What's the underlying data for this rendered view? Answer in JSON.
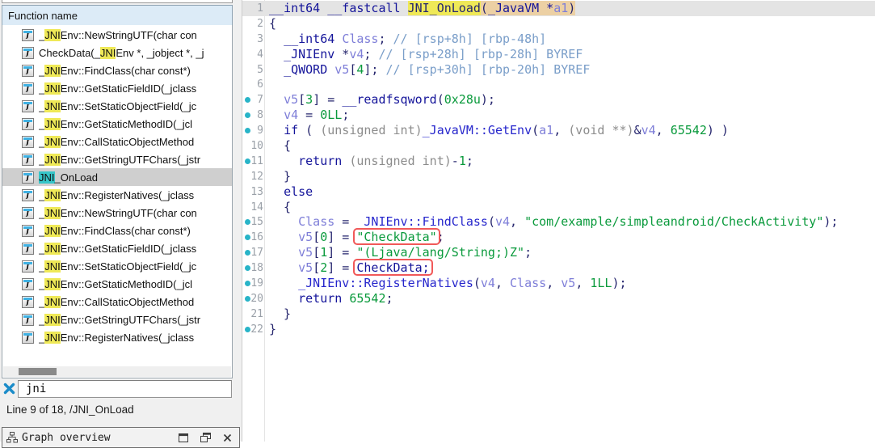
{
  "function_list": {
    "header": "Function name",
    "icon_glyph": "f",
    "items": [
      {
        "pre": "_",
        "hl": "JNI",
        "post": "Env::NewStringUTF(char con",
        "selected": false
      },
      {
        "pre": "CheckData(_",
        "hl": "JNI",
        "post": "Env *, _jobject *, _j",
        "selected": false
      },
      {
        "pre": "_",
        "hl": "JNI",
        "post": "Env::FindClass(char const*)",
        "selected": false
      },
      {
        "pre": "_",
        "hl": "JNI",
        "post": "Env::GetStaticFieldID(_jclass",
        "selected": false
      },
      {
        "pre": "_",
        "hl": "JNI",
        "post": "Env::SetStaticObjectField(_jc",
        "selected": false
      },
      {
        "pre": "_",
        "hl": "JNI",
        "post": "Env::GetStaticMethodID(_jcl",
        "selected": false
      },
      {
        "pre": "_",
        "hl": "JNI",
        "post": "Env::CallStaticObjectMethod",
        "selected": false
      },
      {
        "pre": "_",
        "hl": "JNI",
        "post": "Env::GetStringUTFChars(_jstr",
        "selected": false
      },
      {
        "pre": "",
        "hl": "JNI",
        "post": "_OnLoad",
        "selected": true
      },
      {
        "pre": "_",
        "hl": "JNI",
        "post": "Env::RegisterNatives(_jclass ",
        "selected": false
      },
      {
        "pre": "_",
        "hl": "JNI",
        "post": "Env::NewStringUTF(char con",
        "selected": false
      },
      {
        "pre": "_",
        "hl": "JNI",
        "post": "Env::FindClass(char const*)",
        "selected": false
      },
      {
        "pre": "_",
        "hl": "JNI",
        "post": "Env::GetStaticFieldID(_jclass",
        "selected": false
      },
      {
        "pre": "_",
        "hl": "JNI",
        "post": "Env::SetStaticObjectField(_jc",
        "selected": false
      },
      {
        "pre": "_",
        "hl": "JNI",
        "post": "Env::GetStaticMethodID(_jcl",
        "selected": false
      },
      {
        "pre": "_",
        "hl": "JNI",
        "post": "Env::CallStaticObjectMethod",
        "selected": false
      },
      {
        "pre": "_",
        "hl": "JNI",
        "post": "Env::GetStringUTFChars(_jstr",
        "selected": false
      },
      {
        "pre": "_",
        "hl": "JNI",
        "post": "Env::RegisterNatives(_jclass ",
        "selected": false
      }
    ]
  },
  "search": {
    "value": "jni"
  },
  "status": "Line 9 of 18, /JNI_OnLoad",
  "overview_panel": {
    "title": "Graph overview"
  },
  "colors": {
    "highlight_yellow": "#efe957",
    "highlight_teal": "#36c5c8",
    "selection_gray": "#cfcfcf",
    "current_line": "#e4e4e4",
    "breakpoint_dot": "#28b4c8",
    "annotation_box_red": "#f15959",
    "search_close_blue": "#1b8cc9",
    "header_blue": "#dcebf7",
    "string_green": "#0a9a3c",
    "keyword_navy": "#14149a",
    "variable_periwinkle": "#7e7ed8",
    "comment_blue": "#7a9ec9"
  },
  "code": {
    "lines": [
      {
        "n": 1,
        "dot": false,
        "current": true,
        "segs": [
          {
            "c": "kw",
            "t": "__int64 __fastcall "
          },
          {
            "c": "def",
            "t": "JNI_OnLoad",
            "bg": "y"
          },
          {
            "c": "def",
            "t": "(",
            "bg": "t"
          },
          {
            "c": "kw",
            "t": "_JavaVM *",
            "bg": "t"
          },
          {
            "c": "var",
            "t": "a1",
            "bg": "t"
          },
          {
            "c": "def",
            "t": ")",
            "bg": "t"
          }
        ]
      },
      {
        "n": 2,
        "dot": false,
        "current": false,
        "segs": [
          {
            "c": "def",
            "t": "{"
          }
        ]
      },
      {
        "n": 3,
        "dot": false,
        "current": false,
        "segs": [
          {
            "c": "def",
            "t": "  "
          },
          {
            "c": "kw",
            "t": "__int64"
          },
          {
            "c": "def",
            "t": " "
          },
          {
            "c": "var",
            "t": "Class"
          },
          {
            "c": "def",
            "t": "; "
          },
          {
            "c": "com",
            "t": "// [rsp+8h] [rbp-48h]"
          }
        ]
      },
      {
        "n": 4,
        "dot": false,
        "current": false,
        "segs": [
          {
            "c": "def",
            "t": "  "
          },
          {
            "c": "kw",
            "t": "_JNIEnv"
          },
          {
            "c": "def",
            "t": " *"
          },
          {
            "c": "var",
            "t": "v4"
          },
          {
            "c": "def",
            "t": "; "
          },
          {
            "c": "com",
            "t": "// [rsp+28h] [rbp-28h] BYREF"
          }
        ]
      },
      {
        "n": 5,
        "dot": false,
        "current": false,
        "segs": [
          {
            "c": "def",
            "t": "  "
          },
          {
            "c": "kw",
            "t": "_QWORD"
          },
          {
            "c": "def",
            "t": " "
          },
          {
            "c": "var",
            "t": "v5"
          },
          {
            "c": "def",
            "t": "["
          },
          {
            "c": "grn",
            "t": "4"
          },
          {
            "c": "def",
            "t": "]; "
          },
          {
            "c": "com",
            "t": "// [rsp+30h] [rbp-20h] BYREF"
          }
        ]
      },
      {
        "n": 6,
        "dot": false,
        "current": false,
        "segs": []
      },
      {
        "n": 7,
        "dot": true,
        "current": false,
        "segs": [
          {
            "c": "def",
            "t": "  "
          },
          {
            "c": "var",
            "t": "v5"
          },
          {
            "c": "def",
            "t": "["
          },
          {
            "c": "grn",
            "t": "3"
          },
          {
            "c": "def",
            "t": "] = "
          },
          {
            "c": "kw",
            "t": "__readfsqword"
          },
          {
            "c": "def",
            "t": "("
          },
          {
            "c": "grn",
            "t": "0x28u"
          },
          {
            "c": "def",
            "t": ");"
          }
        ]
      },
      {
        "n": 8,
        "dot": true,
        "current": false,
        "segs": [
          {
            "c": "def",
            "t": "  "
          },
          {
            "c": "var",
            "t": "v4"
          },
          {
            "c": "def",
            "t": " = "
          },
          {
            "c": "grn",
            "t": "0LL"
          },
          {
            "c": "def",
            "t": ";"
          }
        ]
      },
      {
        "n": 9,
        "dot": true,
        "current": false,
        "segs": [
          {
            "c": "def",
            "t": "  "
          },
          {
            "c": "kw",
            "t": "if"
          },
          {
            "c": "def",
            "t": " ( "
          },
          {
            "c": "gray",
            "t": "(unsigned int)"
          },
          {
            "c": "fn",
            "t": "_JavaVM::GetEnv"
          },
          {
            "c": "def",
            "t": "("
          },
          {
            "c": "var",
            "t": "a1"
          },
          {
            "c": "def",
            "t": ", "
          },
          {
            "c": "gray",
            "t": "(void **)"
          },
          {
            "c": "def",
            "t": "&"
          },
          {
            "c": "var",
            "t": "v4"
          },
          {
            "c": "def",
            "t": ", "
          },
          {
            "c": "grn",
            "t": "65542"
          },
          {
            "c": "def",
            "t": ") )"
          }
        ]
      },
      {
        "n": 10,
        "dot": false,
        "current": false,
        "segs": [
          {
            "c": "def",
            "t": "  {"
          }
        ]
      },
      {
        "n": 11,
        "dot": true,
        "current": false,
        "segs": [
          {
            "c": "def",
            "t": "    "
          },
          {
            "c": "kw",
            "t": "return"
          },
          {
            "c": "def",
            "t": " "
          },
          {
            "c": "gray",
            "t": "(unsigned int)"
          },
          {
            "c": "def",
            "t": "-"
          },
          {
            "c": "grn",
            "t": "1"
          },
          {
            "c": "def",
            "t": ";"
          }
        ]
      },
      {
        "n": 12,
        "dot": false,
        "current": false,
        "segs": [
          {
            "c": "def",
            "t": "  }"
          }
        ]
      },
      {
        "n": 13,
        "dot": false,
        "current": false,
        "segs": [
          {
            "c": "def",
            "t": "  "
          },
          {
            "c": "kw",
            "t": "else"
          }
        ]
      },
      {
        "n": 14,
        "dot": false,
        "current": false,
        "segs": [
          {
            "c": "def",
            "t": "  {"
          }
        ]
      },
      {
        "n": 15,
        "dot": true,
        "current": false,
        "segs": [
          {
            "c": "def",
            "t": "    "
          },
          {
            "c": "var",
            "t": "Class"
          },
          {
            "c": "def",
            "t": " = "
          },
          {
            "c": "fn",
            "t": "_JNIEnv::FindClass"
          },
          {
            "c": "def",
            "t": "("
          },
          {
            "c": "var",
            "t": "v4"
          },
          {
            "c": "def",
            "t": ", "
          },
          {
            "c": "grn",
            "t": "\"com/example/simpleandroid/CheckActivity\""
          },
          {
            "c": "def",
            "t": ");"
          }
        ]
      },
      {
        "n": 16,
        "dot": true,
        "current": false,
        "segs": [
          {
            "c": "def",
            "t": "    "
          },
          {
            "c": "var",
            "t": "v5"
          },
          {
            "c": "def",
            "t": "["
          },
          {
            "c": "grn",
            "t": "0"
          },
          {
            "c": "def",
            "t": "] = "
          },
          {
            "c": "grn",
            "t": "\"CheckData\"",
            "b": true
          },
          {
            "c": "def",
            "t": ";"
          }
        ]
      },
      {
        "n": 17,
        "dot": true,
        "current": false,
        "segs": [
          {
            "c": "def",
            "t": "    "
          },
          {
            "c": "var",
            "t": "v5"
          },
          {
            "c": "def",
            "t": "["
          },
          {
            "c": "grn",
            "t": "1"
          },
          {
            "c": "def",
            "t": "] = "
          },
          {
            "c": "grn",
            "t": "\"(Ljava/lang/String;)Z\""
          },
          {
            "c": "def",
            "t": ";"
          }
        ]
      },
      {
        "n": 18,
        "dot": true,
        "current": false,
        "segs": [
          {
            "c": "def",
            "t": "    "
          },
          {
            "c": "var",
            "t": "v5"
          },
          {
            "c": "def",
            "t": "["
          },
          {
            "c": "grn",
            "t": "2"
          },
          {
            "c": "def",
            "t": "] = "
          },
          {
            "c": "kw",
            "t": "CheckData;",
            "b": true
          }
        ]
      },
      {
        "n": 19,
        "dot": true,
        "current": false,
        "segs": [
          {
            "c": "def",
            "t": "    "
          },
          {
            "c": "fn",
            "t": "_JNIEnv::RegisterNatives"
          },
          {
            "c": "def",
            "t": "("
          },
          {
            "c": "var",
            "t": "v4"
          },
          {
            "c": "def",
            "t": ", "
          },
          {
            "c": "var",
            "t": "Class"
          },
          {
            "c": "def",
            "t": ", "
          },
          {
            "c": "var",
            "t": "v5"
          },
          {
            "c": "def",
            "t": ", "
          },
          {
            "c": "grn",
            "t": "1LL"
          },
          {
            "c": "def",
            "t": ");"
          }
        ]
      },
      {
        "n": 20,
        "dot": true,
        "current": false,
        "segs": [
          {
            "c": "def",
            "t": "    "
          },
          {
            "c": "kw",
            "t": "return"
          },
          {
            "c": "def",
            "t": " "
          },
          {
            "c": "grn",
            "t": "65542"
          },
          {
            "c": "def",
            "t": ";"
          }
        ]
      },
      {
        "n": 21,
        "dot": false,
        "current": false,
        "segs": [
          {
            "c": "def",
            "t": "  }"
          }
        ]
      },
      {
        "n": 22,
        "dot": true,
        "current": false,
        "segs": [
          {
            "c": "def",
            "t": "}"
          }
        ]
      }
    ]
  }
}
